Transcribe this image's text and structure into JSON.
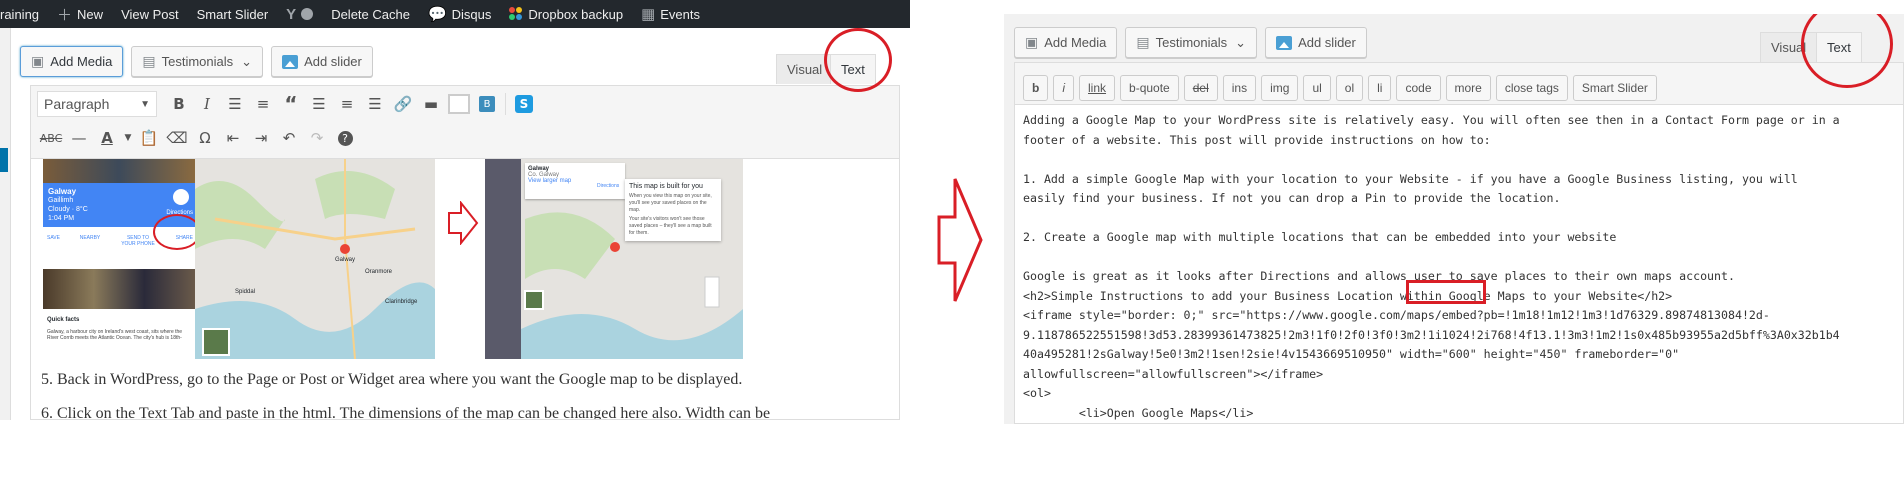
{
  "admin_bar": {
    "items": [
      "raining",
      "New",
      "View Post",
      "Smart Slider",
      "Delete Cache",
      "Disqus",
      "Dropbox backup",
      "Events"
    ],
    "new_icon": "plus-icon",
    "events_icon": "calendar-icon"
  },
  "left": {
    "add_media": "Add Media",
    "testimonials": "Testimonials",
    "add_slider": "Add slider",
    "tab_visual": "Visual",
    "tab_text": "Text",
    "format_select": "Paragraph",
    "toolbar_row1": [
      "bold-icon",
      "italic-icon",
      "bullet-list-icon",
      "numbered-list-icon",
      "blockquote-icon",
      "align-left-icon",
      "align-center-icon",
      "align-right-icon",
      "link-icon",
      "read-more-icon",
      "toolbar-toggle-icon",
      "shortcode-icon",
      "smart-slider-icon"
    ],
    "toolbar_row2": [
      "strikethrough-icon",
      "horizontal-line-icon",
      "text-color-icon",
      "paste-text-icon",
      "clear-format-icon",
      "special-char-icon",
      "outdent-icon",
      "indent-icon",
      "undo-icon",
      "redo-icon",
      "help-icon"
    ],
    "map_card": {
      "place": "Galway",
      "subtitle": "Gaillimh",
      "weather": "Cloudy · 8°C",
      "time": "1:04 PM",
      "actions": [
        "SAVE",
        "NEARBY",
        "SEND TO YOUR PHONE",
        "SHARE"
      ],
      "directions": "Directions",
      "quick_facts_title": "Quick facts",
      "quick_facts_text": "Galway, a harbour city on Ireland's west coast, sits where the River Corrib meets the Atlantic Ocean. The city's hub is 18th-"
    },
    "map_towns": [
      "Galway",
      "Oranmore",
      "Clarinbridge",
      "Spiddal"
    ],
    "embed_card": {
      "place": "Galway",
      "subtitle": "Co. Galway",
      "link": "View larger map",
      "directions": "Directions",
      "popup_title": "This map is built for you",
      "popup_text": "When you view this map on your site, you'll see your saved places on the map.",
      "popup_text2": "Your site's visitors won't see those saved places – they'll see a map built for them."
    },
    "paragraph1": "5. Back in WordPress, go to the Page or Post or Widget area where you want the Google map to be displayed.",
    "paragraph2": "6. Click on the Text Tab and paste in the html. The dimensions of the map can be changed here also. Width can be"
  },
  "right": {
    "add_media": "Add Media",
    "testimonials": "Testimonials",
    "add_slider": "Add slider",
    "tab_visual": "Visual",
    "tab_text": "Text",
    "quicktags": [
      "b",
      "i",
      "link",
      "b-quote",
      "del",
      "ins",
      "img",
      "ul",
      "ol",
      "li",
      "code",
      "more",
      "close tags",
      "Smart Slider"
    ],
    "lines": [
      "Adding a Google Map to your WordPress site is relatively easy. You will often see then in a Contact Form page or in a",
      "footer of a website. This post will provide instructions on how to:",
      "",
      "1. Add a simple Google Map with your location to your Website - if you have a Google Business listing, you will",
      "easily find your business. If not you can drop a Pin to provide the location.",
      "",
      "2. Create a Google map with multiple locations that can be embedded into your website",
      "",
      "Google is great as it looks after Directions and allows user to save places to their own maps account.",
      "<h2>Simple Instructions to add your Business Location within Google Maps to your Website</h2>",
      "<iframe style=\"border: 0;\" src=\"https://www.google.com/maps/embed?pb=!1m18!1m12!1m3!1d76329.89874813084!2d-",
      "9.118786522551598!3d53.28399361473825!2m3!1f0!2f0!3f0!3m2!1i1024!2i768!4f13.1!3m3!1m2!1s0x485b93955a2d5bff%3A0x32b1b4",
      "40a495281!2sGalway!5e0!3m2!1sen!2sie!4v1543669510950\" width=\"600\" height=\"450\" frameborder=\"0\"",
      "allowfullscreen=\"allowfullscreen\"></iframe>",
      "<ol>",
      "        <li>Open Google Maps</li>"
    ]
  },
  "colors": {
    "annotation_red": "#d91e26",
    "wp_blue": "#4285f4",
    "admin_bar": "#23282d"
  }
}
